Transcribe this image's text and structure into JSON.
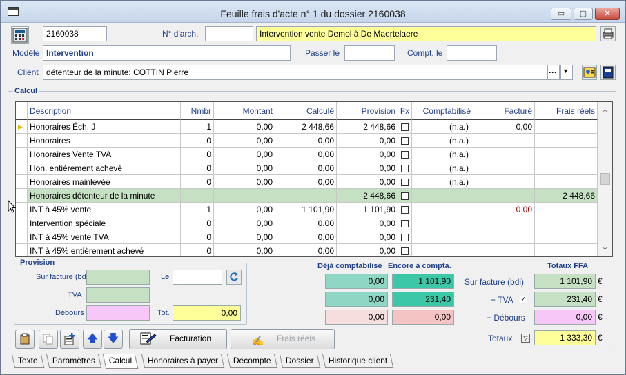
{
  "window": {
    "title": "Feuille frais d'acte n° 1 du dossier 2160038",
    "min": "▭",
    "max": "▢",
    "close": "✕"
  },
  "header": {
    "dossier": "2160038",
    "archive_label": "N° d'arch.",
    "archive_value": "",
    "subject": "Intervention vente Demol à De Maertelaere",
    "modele_label": "Modèle",
    "modele_value": "Intervention",
    "passer_label": "Passer le",
    "passer_value": "",
    "compt_label": "Compt. le",
    "compt_value": "",
    "client_label": "Client",
    "client_value": "détenteur de la minute: COTTIN Pierre",
    "client_dots": "···",
    "client_arrow": "▼"
  },
  "calcul": {
    "title": "Calcul",
    "columns": [
      "Description",
      "Nmbr",
      "Montant",
      "Calculé",
      "Provision",
      "Fx",
      "Comptabilisé",
      "Facturé",
      "Frais réels"
    ],
    "rows": [
      {
        "desc": "Honoraires Éch. J",
        "nmbr": "1",
        "montant": "0,00",
        "calcule": "2 448,66",
        "provision": "2 448,66",
        "compta": "(n.a.)",
        "facture": "0,00",
        "frais": "",
        "current": true
      },
      {
        "desc": "Honoraires",
        "nmbr": "0",
        "montant": "0,00",
        "calcule": "0,00",
        "provision": "0,00",
        "compta": "(n.a.)",
        "facture": "",
        "frais": ""
      },
      {
        "desc": "Honoraires Vente TVA",
        "nmbr": "0",
        "montant": "0,00",
        "calcule": "0,00",
        "provision": "0,00",
        "compta": "(n.a.)",
        "facture": "",
        "frais": ""
      },
      {
        "desc": "Hon. entièrement achevé",
        "nmbr": "0",
        "montant": "0,00",
        "calcule": "0,00",
        "provision": "0,00",
        "compta": "(n.a.)",
        "facture": "",
        "frais": ""
      },
      {
        "desc": "Honoraires mainlevée",
        "nmbr": "0",
        "montant": "0,00",
        "calcule": "0,00",
        "provision": "0,00",
        "compta": "(n.a.)",
        "facture": "",
        "frais": ""
      },
      {
        "desc": "Honoraires détenteur de la minute",
        "nmbr": "",
        "montant": "",
        "calcule": "",
        "provision": "2 448,66",
        "compta": "",
        "facture": "",
        "frais": "2 448,66",
        "selected": true
      },
      {
        "desc": "INT à 45% vente",
        "nmbr": "1",
        "montant": "0,00",
        "calcule": "1 101,90",
        "provision": "1 101,90",
        "compta": "",
        "facture": "0,00",
        "frais": "",
        "facture_red": true
      },
      {
        "desc": "Intervention spéciale",
        "nmbr": "0",
        "montant": "0,00",
        "calcule": "0,00",
        "provision": "0,00",
        "compta": "",
        "facture": "",
        "frais": ""
      },
      {
        "desc": "INT à 45% vente TVA",
        "nmbr": "0",
        "montant": "0,00",
        "calcule": "0,00",
        "provision": "0,00",
        "compta": "",
        "facture": "",
        "frais": ""
      },
      {
        "desc": "INT à 45% entièrement achevé",
        "nmbr": "0",
        "montant": "0,00",
        "calcule": "0,00",
        "provision": "0,00",
        "compta": "",
        "facture": "",
        "frais": ""
      }
    ]
  },
  "provision": {
    "title": "Provision",
    "sur_facture_label": "Sur facture (bdi)",
    "sur_facture_value": "",
    "tva_label": "TVA",
    "tva_value": "",
    "debours_label": "Débours",
    "debours_value": "",
    "le_label": "Le",
    "le_value": "",
    "tot_label": "Tot.",
    "tot_value": "0,00"
  },
  "compta": {
    "deja_label": "Déjà comptabilisé",
    "encore_label": "Encore à compta.",
    "deja": [
      "0,00",
      "0,00",
      "0,00"
    ],
    "encore": [
      "1 101,90",
      "231,40",
      "0,00"
    ]
  },
  "totaux": {
    "title": "Totaux FFA",
    "sur_facture_label": "Sur facture (bdi)",
    "sur_facture_value": "1 101,90",
    "tva_label": "+ TVA",
    "tva_value": "231,40",
    "debours_label": "+ Débours",
    "debours_value": "0,00",
    "totaux_label": "Totaux",
    "totaux_value": "1 333,30",
    "currency": "€"
  },
  "buttons": {
    "facturation": "Facturation",
    "frais_reels": "Frais réels"
  },
  "tabs": [
    "Texte",
    "Paramètres",
    "Calcul",
    "Honoraires à payer",
    "Décompte",
    "Dossier",
    "Historique client"
  ],
  "colors": {
    "green": "#c5e0c2",
    "teal": "#8fd7c4",
    "pink": "#f4d5d5",
    "yellow": "#ffff99",
    "lilac": "#f7c8f7"
  }
}
